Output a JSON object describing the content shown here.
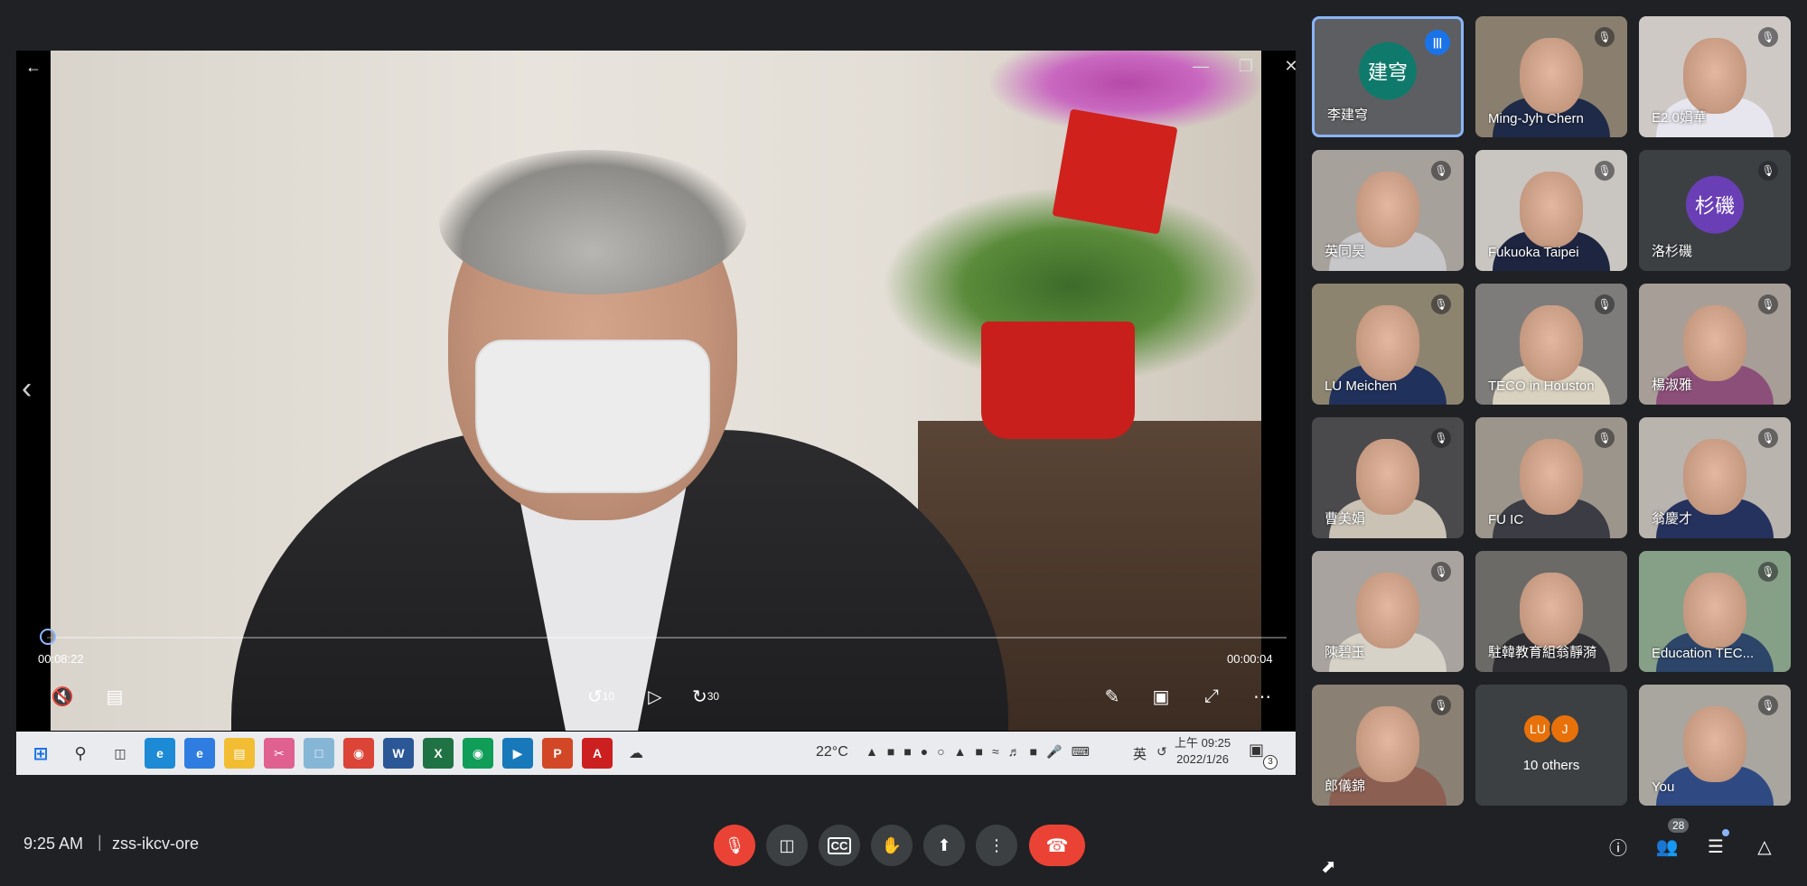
{
  "presentation": {
    "time_current": "00:08:22",
    "time_end": "00:00:04",
    "progress": 0.0,
    "skip_back_label": "10",
    "skip_forward_label": "30"
  },
  "taskbar": {
    "temperature": "22°C",
    "ime": "英",
    "clock_time": "上午 09:25",
    "clock_date": "2022/1/26",
    "notification_count": "3"
  },
  "participants": [
    {
      "name": "李建穹",
      "avatar": "建穹",
      "avatar_color": "#0f7a6b",
      "active": true,
      "speaking": true
    },
    {
      "name": "Ming-Jyh Chern",
      "muted": true
    },
    {
      "name": "E2.0娟華",
      "muted": true
    },
    {
      "name": "英同昊",
      "muted": true
    },
    {
      "name": "Fukuoka Taipei",
      "muted": true
    },
    {
      "name": "洛杉磯",
      "avatar": "杉磯",
      "avatar_color": "#6a3fb5",
      "muted": true
    },
    {
      "name": "LU Meichen",
      "muted": true
    },
    {
      "name": "TECO in Houston",
      "muted": true
    },
    {
      "name": "楊淑雅",
      "muted": true
    },
    {
      "name": "曹美娟",
      "muted": true
    },
    {
      "name": "FU IC",
      "muted": true
    },
    {
      "name": "翁慶才",
      "muted": true
    },
    {
      "name": "陳碧玉",
      "muted": true
    },
    {
      "name": "駐韓教育組翁靜漪",
      "muted": false
    },
    {
      "name": "Education TEC...",
      "muted": true
    },
    {
      "name": "郎儀錦",
      "muted": true
    },
    {
      "name": "10 others",
      "others": true,
      "avatars": [
        "LU",
        "J"
      ]
    },
    {
      "name": "You",
      "muted": true
    }
  ],
  "bottom_bar": {
    "time": "9:25 AM",
    "separator": "|",
    "meeting_code": "zss-ikcv-ore",
    "people_count": "28"
  },
  "colors": {
    "end_call": "#ea4335",
    "accent": "#8ab4f8",
    "background": "#202124"
  }
}
